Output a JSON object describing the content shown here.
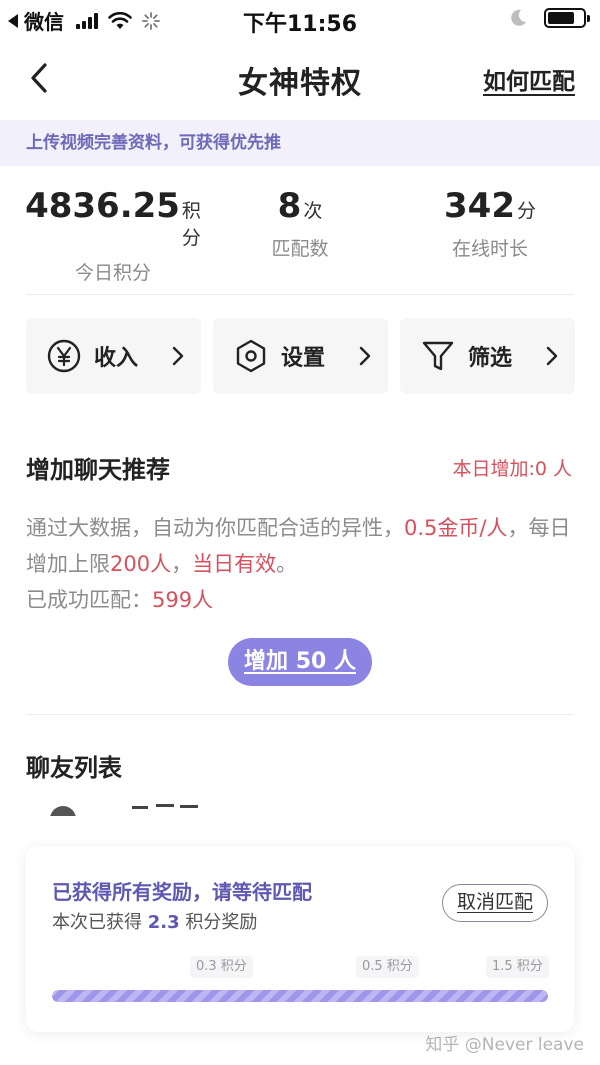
{
  "status_bar": {
    "carrier": "微信",
    "time": "下午11:56",
    "battery_level": 0.75
  },
  "nav": {
    "title": "女神特权",
    "right_link": "如何匹配"
  },
  "banner": {
    "text": "上传视频完善资料，可获得优先推"
  },
  "stats": [
    {
      "value": "4836.25",
      "unit": "积分",
      "label": "今日积分"
    },
    {
      "value": "8",
      "unit": "次",
      "label": "匹配数"
    },
    {
      "value": "342",
      "unit": "分",
      "label": "在线时长"
    }
  ],
  "actions": [
    {
      "label": "收入",
      "icon": "yen-icon"
    },
    {
      "label": "设置",
      "icon": "hexagon-settings-icon"
    },
    {
      "label": "筛选",
      "icon": "filter-icon"
    }
  ],
  "recommend": {
    "title": "增加聊天推荐",
    "today_added": "本日增加:0 人",
    "desc_part1": "通过大数据，自动为你匹配合适的异性，",
    "desc_price": "0.5金币/人",
    "desc_part2": "，每日增加上限",
    "desc_limit": "200人",
    "desc_part3": "，",
    "desc_valid": "当日有效",
    "desc_part4": "。",
    "matched_label": "已成功匹配：",
    "matched_value": "599人",
    "button": "增加 50 人"
  },
  "friends": {
    "title": "聊友列表"
  },
  "reward_card": {
    "title": "已获得所有奖励，请等待匹配",
    "sub_prefix": "本次已获得 ",
    "sub_amount": "2.3",
    "sub_suffix": " 积分奖励",
    "cancel_button": "取消匹配",
    "milestones": [
      "0.3 积分",
      "0.5 积分",
      "1.5 积分"
    ],
    "progress": 1.0
  },
  "watermark": "知乎 @Never leave",
  "colors": {
    "accent": "#8c84e3",
    "accent_text": "#5e58b3",
    "highlight_red": "#d8505d",
    "banner_bg": "#f1f0fb"
  }
}
